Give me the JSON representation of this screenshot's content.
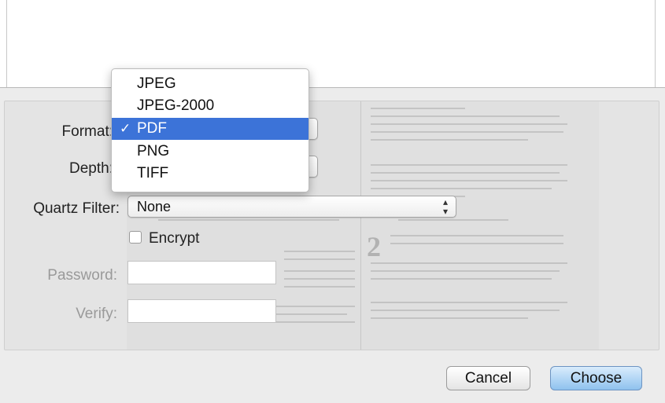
{
  "format": {
    "label": "Format:",
    "options": [
      {
        "label": "JPEG",
        "selected": false
      },
      {
        "label": "JPEG-2000",
        "selected": false
      },
      {
        "label": "PDF",
        "selected": true
      },
      {
        "label": "PNG",
        "selected": false
      },
      {
        "label": "TIFF",
        "selected": false
      }
    ],
    "checkmark": "✓"
  },
  "depth": {
    "label": "Depth:"
  },
  "quartz_filter": {
    "label": "Quartz Filter:",
    "value": "None"
  },
  "encrypt": {
    "label": "Encrypt",
    "checked": false
  },
  "password": {
    "label": "Password:",
    "value": ""
  },
  "verify": {
    "label": "Verify:",
    "value": ""
  },
  "buttons": {
    "cancel": "Cancel",
    "choose": "Choose"
  },
  "preview": {
    "big_number": "2"
  },
  "colors": {
    "selection": "#3c73d8",
    "primary_button": "#8fc2ee",
    "dim_label": "#9a9a9a"
  }
}
